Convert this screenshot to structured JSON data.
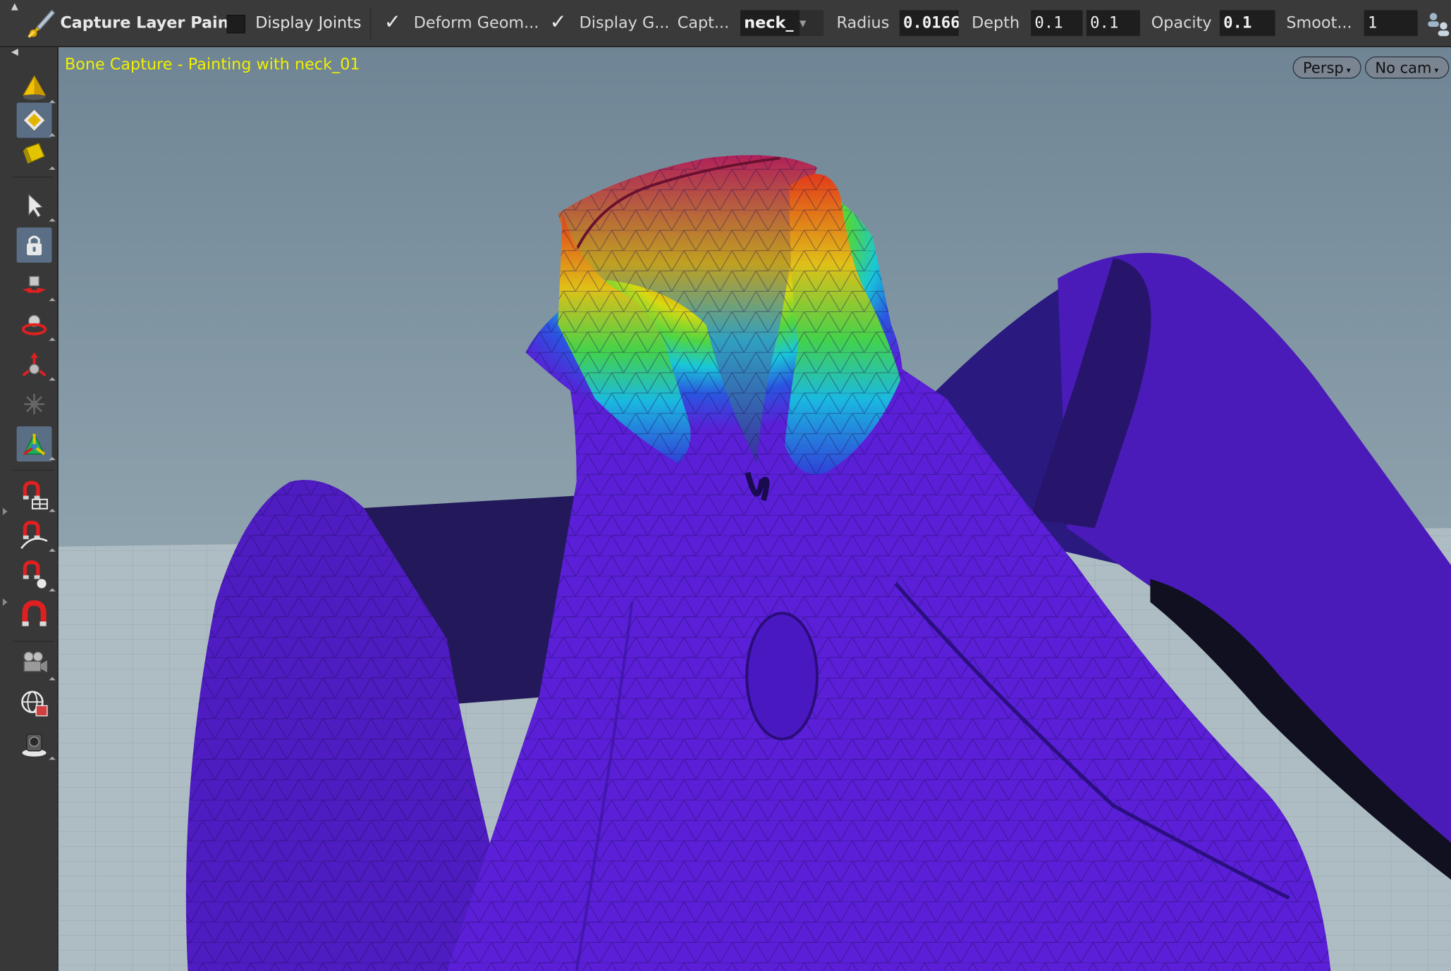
{
  "toolbar": {
    "title": "Capture Layer Paint",
    "display_joints_label": "Display Joints",
    "display_joints_checked": false,
    "deform_geom_label": "Deform Geom...",
    "deform_geom_checked": true,
    "display_g_label": "Display G...",
    "display_g_checked": true,
    "capture_label": "Capt...",
    "capture_value": "neck_",
    "radius_label": "Radius",
    "radius_value": "0.0166",
    "depth_label": "Depth",
    "depth_value_1": "0.1",
    "depth_value_2": "0.1",
    "opacity_label": "Opacity",
    "opacity_value": "0.1",
    "smooth_label": "Smoot...",
    "smooth_value": "1",
    "dropdown_glyph": "▼",
    "check_glyph": "✓"
  },
  "shelf": {
    "tools": [
      {
        "name": "object-mode-icon",
        "active": false
      },
      {
        "name": "component-mode-icon",
        "active": true
      },
      {
        "name": "dynamics-mode-icon",
        "active": false
      },
      {
        "name": "select-arrow-icon",
        "active": false
      },
      {
        "name": "lock-icon",
        "active": true
      },
      {
        "name": "move-tool-icon",
        "active": false
      },
      {
        "name": "rotate-tool-icon",
        "active": false
      },
      {
        "name": "scale-tool-icon",
        "active": false
      },
      {
        "name": "pose-tool-icon",
        "active": false
      },
      {
        "name": "handle-tool-icon",
        "active": true
      },
      {
        "name": "snap-grid-icon",
        "active": false
      },
      {
        "name": "snap-curve-icon",
        "active": false
      },
      {
        "name": "snap-point-icon",
        "active": false
      },
      {
        "name": "magnet-icon",
        "active": false
      },
      {
        "name": "camera-icon",
        "active": false
      },
      {
        "name": "view-globe-icon",
        "active": false
      },
      {
        "name": "render-icon",
        "active": false
      }
    ]
  },
  "viewport": {
    "title": "Bone Capture - Painting with neck_01",
    "persp_label": "Persp",
    "camera_label": "No cam",
    "caret_glyph": "▾"
  },
  "colors": {
    "toolbar_bg": "#3a3a3a",
    "viewport_title": "#f0f000",
    "mesh_purple": "#5a1fd6",
    "sky_top": "#6e8494",
    "floor": "#b4c2c8"
  }
}
